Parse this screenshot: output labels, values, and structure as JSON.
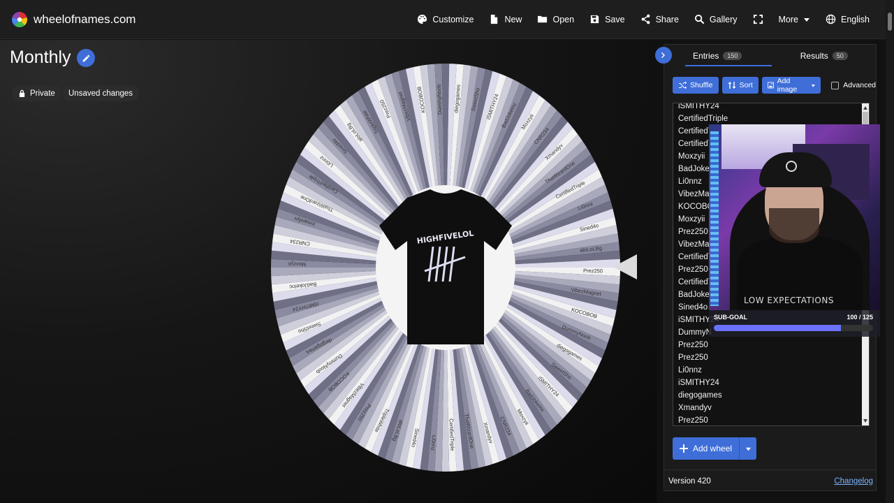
{
  "app": {
    "site": "wheelofnames.com"
  },
  "toolbar": {
    "customize": "Customize",
    "new": "New",
    "open": "Open",
    "save": "Save",
    "share": "Share",
    "gallery": "Gallery",
    "more": "More",
    "language": "English"
  },
  "wheel": {
    "title": "Monthly",
    "private_label": "Private",
    "unsaved_label": "Unsaved changes",
    "center_print": "HIGHFIVELOL",
    "segment_names": [
      "Prez250",
      "iSMITHY24",
      "CertifiedTriple",
      "VibezMagnet",
      "BadJokeInc",
      "Li0nnz",
      "KOCOBOB",
      "Moxzyii",
      "Sined4o",
      "DummyNoob",
      "CNR234",
      "aloLoLBg",
      "diegogames",
      "Xmandyv",
      "TripleWhite",
      "SweetSho",
      "ThaWizardOne"
    ]
  },
  "panel": {
    "tabs": [
      {
        "label": "Entries",
        "count": "150"
      },
      {
        "label": "Results",
        "count": "50"
      }
    ],
    "tools": {
      "shuffle": "Shuffle",
      "sort": "Sort",
      "add_image": "Add image",
      "advanced": "Advanced"
    },
    "entries": [
      "iSMITHY24",
      "CertifiedTriple",
      "CertifiedTr",
      "CertifiedTr",
      "Moxzyii",
      "BadJokeIn",
      "Li0nnz",
      "VibezMag",
      "KOCOBOB",
      "Moxzyii",
      "Prez250",
      "VibezMag",
      "CertifiedTr",
      "Prez250",
      "CertifiedTr",
      "BadJokeIn",
      "Sined4o",
      "iSMITHY24",
      "DummyN",
      "Prez250",
      "Prez250",
      "Li0nnz",
      "iSMITHY24",
      "diegogames",
      "Xmandyv",
      "Prez250"
    ],
    "add_wheel": "Add wheel",
    "version": "Version 420",
    "changelog": "Changelog"
  },
  "overlay": {
    "shirt_text": "LOW EXPECTATIONS",
    "subgoal_label": "SUB-GOAL",
    "subgoal_count": "100 / 125",
    "subgoal_progress": 0.8
  },
  "colors": {
    "accent": "#3f6ed8",
    "topbar": "#1e1e1e",
    "panel": "#1b1b1b"
  }
}
